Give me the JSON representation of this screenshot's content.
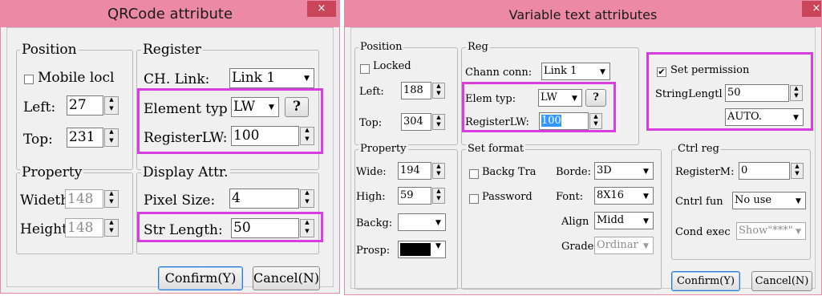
{
  "qrcode_dialog": {
    "title": "QRCode attribute",
    "close_glyph": "×",
    "position": {
      "legend": "Position",
      "mobile_lock_label": "Mobile locl",
      "mobile_lock_checked": false,
      "left_label": "Left:",
      "left_value": "27",
      "top_label": "Top:",
      "top_value": "231"
    },
    "register": {
      "legend": "Register",
      "ch_link_label": "CH. Link:",
      "ch_link_value": "Link 1",
      "element_type_label": "Element typ",
      "element_type_value": "LW",
      "help_label": "?",
      "register_label": "RegisterLW:",
      "register_value": "100"
    },
    "property": {
      "legend": "Property",
      "width_label": "Wideth",
      "width_value": "148",
      "height_label": "Height",
      "height_value": "148"
    },
    "display": {
      "legend": "Display Attr.",
      "pixel_size_label": "Pixel Size:",
      "pixel_size_value": "4",
      "str_length_label": "Str Length:",
      "str_length_value": "50"
    },
    "confirm_label": "Confirm(Y)",
    "cancel_label": "Cancel(N)"
  },
  "vartext_dialog": {
    "title": "Variable text attributes",
    "close_glyph": "×",
    "position": {
      "legend": "Position",
      "locked_label": "Locked",
      "locked_checked": false,
      "left_label": "Left:",
      "left_value": "188",
      "top_label": "Top:",
      "top_value": "304"
    },
    "reg": {
      "legend": "Reg",
      "chann_conn_label": "Chann conn:",
      "chann_conn_value": "Link 1",
      "elem_typ_label": "Elem typ:",
      "elem_typ_value": "LW",
      "help_label": "?",
      "register_label": "RegisterLW:",
      "register_value": "100"
    },
    "permission": {
      "set_permission_label": "Set permission",
      "set_permission_checked": true,
      "string_length_label": "StringLengtl",
      "string_length_value": "50",
      "mode_value": "AUTO."
    },
    "property": {
      "legend": "Property",
      "wide_label": "Wide:",
      "wide_value": "194",
      "high_label": "High:",
      "high_value": "59",
      "backg_label": "Backg:",
      "backg_value": "",
      "prosp_label": "Prosp:",
      "prosp_color": "#000000"
    },
    "set_format": {
      "legend": "Set format",
      "backg_tra_label": "Backg Tra",
      "backg_tra_checked": false,
      "password_label": "Password",
      "password_checked": false,
      "border_label": "Borde:",
      "border_value": "3D",
      "font_label": "Font:",
      "font_value": "8X16",
      "align_label": "Align",
      "align_value": "Midd",
      "grade_label": "Grade",
      "grade_value": "Ordinar"
    },
    "ctrl_reg": {
      "legend": "Ctrl reg",
      "register_m_label": "RegisterM:",
      "register_m_value": "0",
      "cntrl_fun_label": "Cntrl fun",
      "cntrl_fun_value": "No use",
      "cond_exec_label": "Cond exec",
      "cond_exec_value": "Show\"***\""
    },
    "confirm_label": "Confirm(Y)",
    "cancel_label": "Cancel(N)"
  },
  "colors": {
    "titlebar": "#ec8aa6",
    "close_button": "#c9455a",
    "highlight": "#d83de0",
    "dialog_bg": "#f0f0f0",
    "selection": "#3399ff"
  }
}
